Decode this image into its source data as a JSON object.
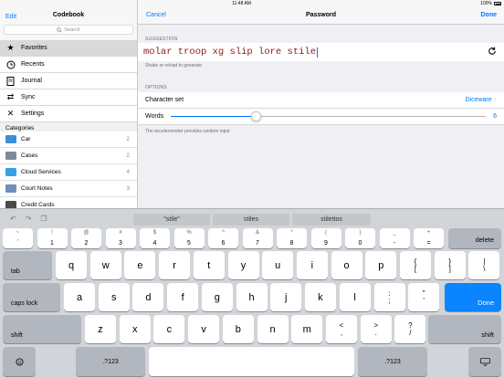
{
  "status": {
    "time": "11:48 AM",
    "battery": "100%"
  },
  "sidebar": {
    "edit": "Edit",
    "title": "Codebook",
    "search_placeholder": "Search",
    "menu": [
      {
        "label": "Favorites",
        "icon": "star-icon"
      },
      {
        "label": "Recents",
        "icon": "clock-icon"
      },
      {
        "label": "Journal",
        "icon": "journal-icon"
      },
      {
        "label": "Sync",
        "icon": "sync-icon"
      },
      {
        "label": "Settings",
        "icon": "settings-icon"
      }
    ],
    "categories_header": "Categories",
    "categories": [
      {
        "label": "Car",
        "count": "2",
        "color": "#3d8fd6"
      },
      {
        "label": "Cases",
        "count": "2",
        "color": "#7c8a99"
      },
      {
        "label": "Cloud Services",
        "count": "4",
        "color": "#3aa1e0"
      },
      {
        "label": "Court Notes",
        "count": "3",
        "color": "#6d8fb8"
      },
      {
        "label": "Credit Cards",
        "count": "",
        "color": "#4a4a4a"
      }
    ]
  },
  "main": {
    "cancel": "Cancel",
    "title": "Password",
    "done": "Done",
    "suggestion_header": "SUGGESTION",
    "suggestion": "molar troop xg slip lore stile",
    "suggestion_note": "Shake or reload to generate",
    "options_header": "OPTIONS",
    "charset_label": "Character set",
    "charset_value": "Diceware",
    "words_label": "Words",
    "words_value": "6",
    "words_level": 0.27,
    "options_note": "The accelerometer provides random input"
  },
  "keyboard": {
    "predictions": [
      "\"stile\"",
      "stiles",
      "stilettos"
    ],
    "row1": [
      {
        "t": "~",
        "b": "`"
      },
      {
        "t": "!",
        "b": "1"
      },
      {
        "t": "@",
        "b": "2"
      },
      {
        "t": "#",
        "b": "3"
      },
      {
        "t": "$",
        "b": "4"
      },
      {
        "t": "%",
        "b": "5"
      },
      {
        "t": "^",
        "b": "6"
      },
      {
        "t": "&",
        "b": "7"
      },
      {
        "t": "*",
        "b": "8"
      },
      {
        "t": "(",
        "b": "9"
      },
      {
        "t": ")",
        "b": "0"
      },
      {
        "t": "_",
        "b": "-"
      },
      {
        "t": "+",
        "b": "="
      }
    ],
    "delete": "delete",
    "tab": "tab",
    "row2": [
      "q",
      "w",
      "e",
      "r",
      "t",
      "y",
      "u",
      "i",
      "o",
      "p"
    ],
    "row2_sym": [
      {
        "t": "{",
        "b": "["
      },
      {
        "t": "}",
        "b": "]"
      },
      {
        "t": "|",
        "b": "\\"
      }
    ],
    "caps": "caps lock",
    "row3": [
      "a",
      "s",
      "d",
      "f",
      "g",
      "h",
      "j",
      "k",
      "l"
    ],
    "row3_sym": [
      {
        "t": ":",
        "b": ";"
      },
      {
        "t": "\"",
        "b": "'"
      }
    ],
    "return": "Done",
    "shift": "shift",
    "row4": [
      "z",
      "x",
      "c",
      "v",
      "b",
      "n",
      "m"
    ],
    "row4_sym": [
      {
        "t": "<",
        "b": ","
      },
      {
        "t": ">",
        "b": "."
      },
      {
        "t": "?",
        "b": "/"
      }
    ],
    "numbers": ".?123"
  }
}
